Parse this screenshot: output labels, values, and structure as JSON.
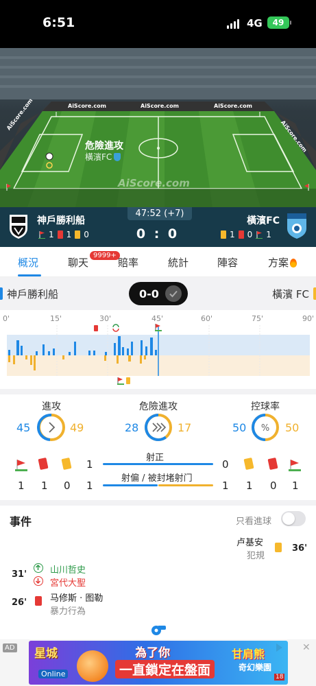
{
  "status_bar": {
    "time": "6:51",
    "network": "4G",
    "battery": "49"
  },
  "pitch": {
    "watermark": "AiScore.com",
    "board_text": "AiScore.com",
    "event_label": "危險進攻",
    "event_team": "橫濱FC"
  },
  "match": {
    "home": {
      "name": "神戶勝利船",
      "corners": "1",
      "red": "1",
      "yellow": "0"
    },
    "away": {
      "name": "橫濱FC",
      "yellow": "1",
      "red": "0",
      "corners": "1"
    },
    "clock": "47:52 (+7)",
    "score": "0 : 0"
  },
  "tabs": [
    {
      "label": "概況",
      "active": true
    },
    {
      "label": "聊天",
      "badge": "9999+"
    },
    {
      "label": "賠率"
    },
    {
      "label": "統計"
    },
    {
      "label": "陣容"
    },
    {
      "label": "方案"
    }
  ],
  "summary": {
    "home": "神戶勝利船",
    "score": "0-0",
    "away": "橫濱 FC"
  },
  "timeline": {
    "ticks": [
      "0'",
      "15'",
      "30'",
      "45'",
      "60'",
      "75'",
      "90'"
    ]
  },
  "stats": {
    "attack": {
      "label": "進攻",
      "home": "45",
      "away": "49"
    },
    "danger": {
      "label": "危險進攻",
      "home": "28",
      "away": "17"
    },
    "possession": {
      "label": "控球率",
      "home": "50",
      "away": "50"
    },
    "shots_on_target": {
      "label": "射正",
      "home": "1",
      "away": "0"
    },
    "shots_off": {
      "label": "射偏 / 被封堵射门",
      "home": "1",
      "away": "1"
    },
    "home_icons": {
      "corners": "1",
      "red": "1",
      "yellow": "0"
    },
    "away_icons": {
      "yellow": "1",
      "red": "0",
      "corners": "1"
    }
  },
  "events": {
    "title": "事件",
    "goal_only_label": "只看進球",
    "items": [
      {
        "minute": "36'",
        "player": "卢基安",
        "detail": "犯規",
        "type": "yellow"
      },
      {
        "minute": "31'",
        "player_in": "山川哲史",
        "player_out": "宮代大聖",
        "type": "substitution"
      },
      {
        "minute": "26'",
        "player": "马修斯 · 图勒",
        "detail": "暴力行為",
        "type": "red"
      }
    ]
  },
  "ad": {
    "tag": "AD",
    "brand": "星城",
    "brand_sub": "Online",
    "headline_1": "為了你",
    "headline_2": "一直鎖定在盤面",
    "promo_1": "甘肩熊",
    "promo_2": "奇幻樂園",
    "rating": "18"
  },
  "colors": {
    "home": "#1e88e5",
    "away": "#f0b12e",
    "accent": "#1e88e5"
  }
}
